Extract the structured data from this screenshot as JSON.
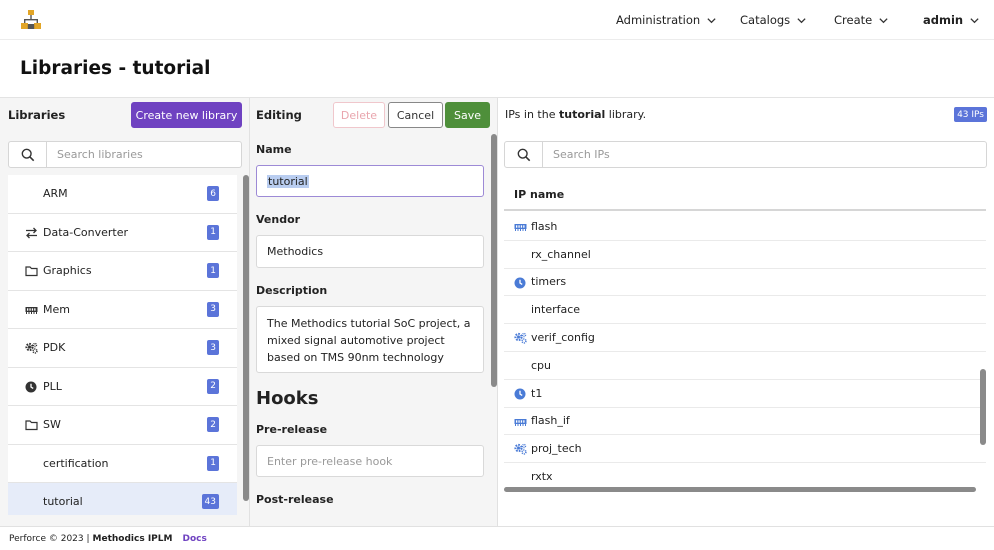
{
  "nav": {
    "items": [
      {
        "label": "Administration",
        "icon": "chevron-down-icon"
      },
      {
        "label": "Catalogs",
        "icon": "chevron-down-icon"
      },
      {
        "label": "Create",
        "icon": "chevron-down-icon"
      },
      {
        "label": "admin",
        "icon": "chevron-down-icon"
      }
    ],
    "logo_color": "#e2a527"
  },
  "page": {
    "title": "Libraries - tutorial"
  },
  "libraries": {
    "heading": "Libraries",
    "create_label": "Create new library",
    "search_placeholder": "Search libraries",
    "items": [
      {
        "name": "ARM",
        "count": "6",
        "icon": ""
      },
      {
        "name": "Data-Converter",
        "count": "1",
        "icon": "arrows-exchange-icon"
      },
      {
        "name": "Graphics",
        "count": "1",
        "icon": "folder-icon"
      },
      {
        "name": "Mem",
        "count": "3",
        "icon": "memory-chip-icon"
      },
      {
        "name": "PDK",
        "count": "3",
        "icon": "gears-icon"
      },
      {
        "name": "PLL",
        "count": "2",
        "icon": "clock-icon"
      },
      {
        "name": "SW",
        "count": "2",
        "icon": "folder-icon"
      },
      {
        "name": "certification",
        "count": "1",
        "icon": ""
      },
      {
        "name": "tutorial",
        "count": "43",
        "icon": "",
        "selected": true
      }
    ]
  },
  "editing": {
    "heading": "Editing",
    "delete_label": "Delete",
    "cancel_label": "Cancel",
    "save_label": "Save",
    "name_label": "Name",
    "name_value": "tutorial",
    "vendor_label": "Vendor",
    "vendor_value": "Methodics",
    "description_label": "Description",
    "description_value": "The Methodics tutorial SoC project, a mixed signal automotive project based on TMS 90nm technology",
    "hooks_title": "Hooks",
    "pre_release_label": "Pre-release",
    "pre_release_placeholder": "Enter pre-release hook",
    "post_release_label": "Post-release"
  },
  "ips": {
    "caption_prefix": "IPs in the",
    "caption_library": "tutorial",
    "caption_suffix": "library.",
    "count_badge": "43 IPs",
    "search_placeholder": "Search IPs",
    "column_header": "IP name",
    "rows": [
      {
        "name": "flash",
        "icon": "memory-chip-icon"
      },
      {
        "name": "rx_channel",
        "icon": ""
      },
      {
        "name": "timers",
        "icon": "clock-icon"
      },
      {
        "name": "interface",
        "icon": ""
      },
      {
        "name": "verif_config",
        "icon": "gears-icon"
      },
      {
        "name": "cpu",
        "icon": ""
      },
      {
        "name": "t1",
        "icon": "clock-icon"
      },
      {
        "name": "flash_if",
        "icon": "memory-chip-icon"
      },
      {
        "name": "proj_tech",
        "icon": "gears-icon"
      },
      {
        "name": "rxtx",
        "icon": ""
      }
    ]
  },
  "footer": {
    "copyright": "Perforce © 2023 |",
    "product": "Methodics IPLM",
    "docs_label": "Docs"
  },
  "colors": {
    "accent_purple": "#6f42c1",
    "save_green": "#4e8f3a",
    "badge_blue": "#5b74d9",
    "ip_icon_blue": "#4a7bd6",
    "selected_row": "#e6ecf9"
  }
}
